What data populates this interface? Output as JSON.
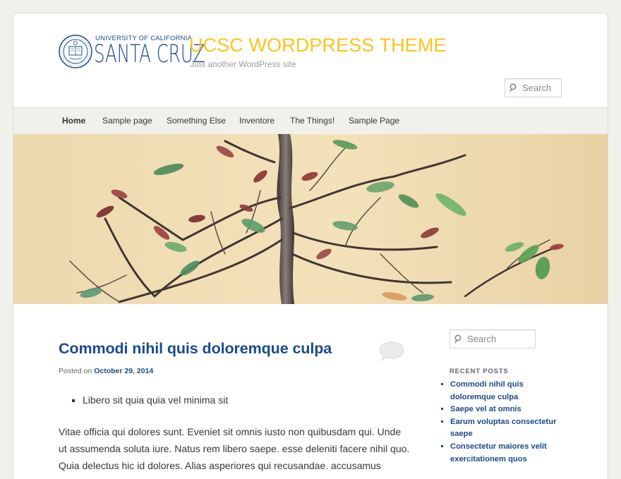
{
  "header": {
    "logo_university": "UNIVERSITY OF CALIFORNIA",
    "logo_campus": "SANTA CRUZ",
    "site_title": "UCSC WORDPRESS THEME",
    "site_description": "Just another WordPress site",
    "search_placeholder": "Search"
  },
  "nav": {
    "items": [
      {
        "label": "Home",
        "active": true
      },
      {
        "label": "Sample page"
      },
      {
        "label": "Something Else"
      },
      {
        "label": "Inventore"
      },
      {
        "label": "The Things!"
      },
      {
        "label": "Sample Page"
      }
    ]
  },
  "post": {
    "title": "Commodi nihil quis doloremque culpa",
    "posted_on_label": "Posted on",
    "date": "October 29, 2014",
    "bullets": [
      "Libero sit quia quia vel minima sit"
    ],
    "body": "Vitae officia qui dolores sunt. Eveniet sit omnis iusto non quibusdam qui. Unde ut assumenda soluta iure. Natus rem libero saepe. esse deleniti facere nihil quo. Quia delectus hic id dolores. Alias asperiores qui recusandae. accusamus"
  },
  "sidebar": {
    "search_placeholder": "Search",
    "recent_heading": "RECENT POSTS",
    "recent_posts": [
      "Commodi nihil quis doloremque culpa",
      "Saepe vel at omnis",
      "Earum voluptas consectetur saepe",
      "Consectetur maiores velit exercitationem quos"
    ]
  },
  "colors": {
    "brand_blue": "#1b4b89",
    "title_gold": "#fdc31a",
    "nav_bg": "#f1f0ea",
    "page_bg": "#f1f0ea"
  },
  "icons": {
    "search": "search-icon",
    "comment": "comment-bubble-icon",
    "seal": "university-seal-icon"
  }
}
